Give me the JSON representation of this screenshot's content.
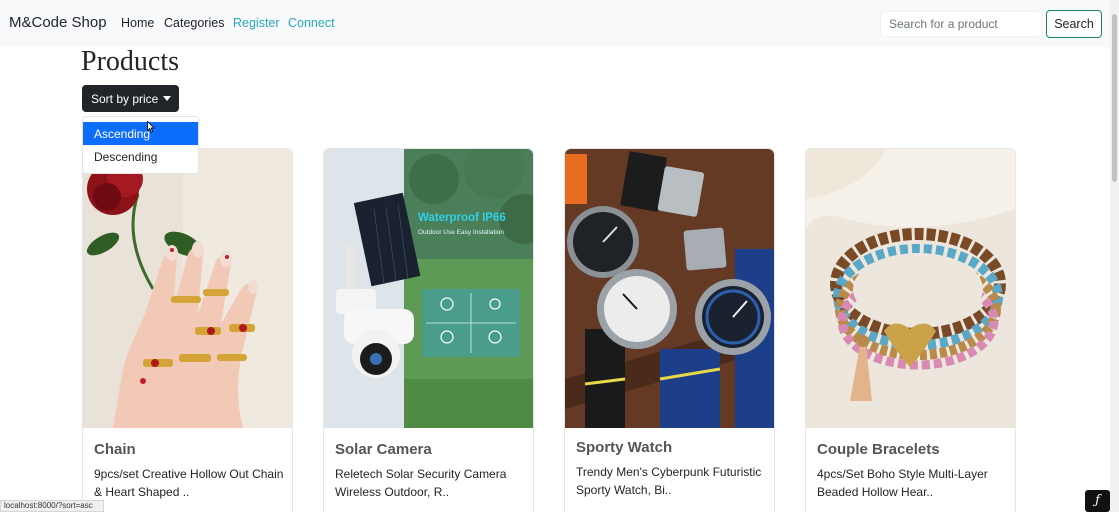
{
  "navbar": {
    "brand": "M&Code Shop",
    "links": [
      "Home",
      "Categories",
      "Register",
      "Connect"
    ],
    "search_placeholder": "Search for a product",
    "search_button": "Search"
  },
  "page": {
    "title": "Products",
    "sort_label": "Sort by price",
    "sort_options": [
      "Ascending",
      "Descending"
    ],
    "highlighted_option": "Ascending"
  },
  "products": [
    {
      "title": "Chain",
      "description": "9pcs/set Creative Hollow Out Chain & Heart Shaped .."
    },
    {
      "title": "Solar Camera",
      "description": "Reletech Solar Security Camera Wireless Outdoor, R.."
    },
    {
      "title": "Sporty Watch",
      "description": "Trendy Men's Cyberpunk Futuristic Sporty Watch, Bi.."
    },
    {
      "title": "Couple Bracelets",
      "description": "4pcs/Set Boho Style Multi-Layer Beaded Hollow Hear.."
    }
  ],
  "camera_overlay": {
    "headline": "Waterproof IP66",
    "subline": "Outdoor Use Easy Installation"
  },
  "status_bar": "localhost:8000/?sort=asc",
  "colors": {
    "accent_link": "#2aa8b8",
    "dropdown_active": "#0d6efd",
    "sort_button": "#212529",
    "search_border": "#198754"
  }
}
